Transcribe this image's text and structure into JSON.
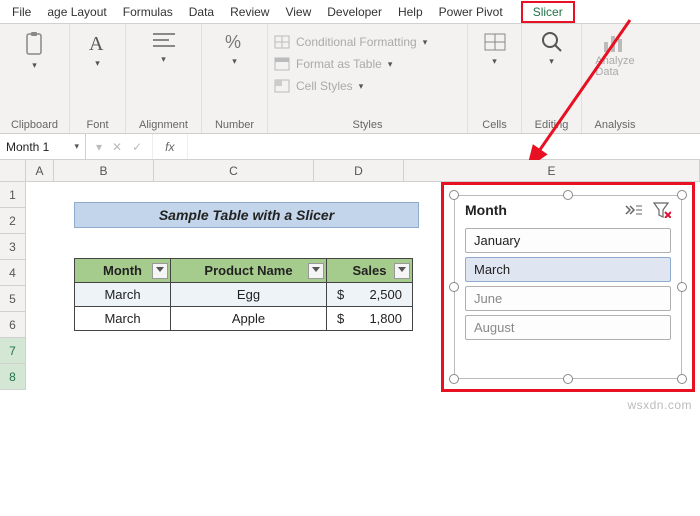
{
  "tabs": {
    "file": "File",
    "pagelayout": "age Layout",
    "formulas": "Formulas",
    "data": "Data",
    "review": "Review",
    "view": "View",
    "developer": "Developer",
    "help": "Help",
    "powerpivot": "Power Pivot",
    "slicer": "Slicer"
  },
  "ribbon": {
    "clipboard": "Clipboard",
    "font": "Font",
    "alignment": "Alignment",
    "number": "Number",
    "styles": "Styles",
    "cells": "Cells",
    "editing": "Editing",
    "analysis": "Analysis",
    "analyze_data": "Analyze\nData",
    "cond_fmt": "Conditional Formatting",
    "fmt_table": "Format as Table",
    "cell_styles": "Cell Styles"
  },
  "name_box": "Month 1",
  "fx_label": "fx",
  "columns": [
    "A",
    "B",
    "C",
    "D",
    "E"
  ],
  "rows": [
    "1",
    "2",
    "3",
    "4",
    "5",
    "6",
    "7",
    "8"
  ],
  "banner": "Sample Table with a Slicer",
  "table": {
    "headers": [
      "Month",
      "Product Name",
      "Sales"
    ],
    "rows": [
      {
        "month": "March",
        "product": "Egg",
        "sales": "2,500",
        "alt": true
      },
      {
        "month": "March",
        "product": "Apple",
        "sales": "1,800",
        "alt": false
      }
    ]
  },
  "slicer": {
    "title": "Month",
    "items": [
      {
        "label": "January",
        "sel": false,
        "avail": true
      },
      {
        "label": "March",
        "sel": true,
        "avail": true
      },
      {
        "label": "June",
        "sel": false,
        "avail": false
      },
      {
        "label": "August",
        "sel": false,
        "avail": false
      }
    ]
  },
  "watermark": "wsxdn.com",
  "chart_data": {
    "type": "table",
    "title": "Sample Table with a Slicer",
    "columns": [
      "Month",
      "Product Name",
      "Sales"
    ],
    "rows": [
      [
        "March",
        "Egg",
        2500
      ],
      [
        "March",
        "Apple",
        1800
      ]
    ],
    "slicer_field": "Month",
    "slicer_selected": [
      "March"
    ],
    "slicer_options": [
      "January",
      "March",
      "June",
      "August"
    ]
  }
}
